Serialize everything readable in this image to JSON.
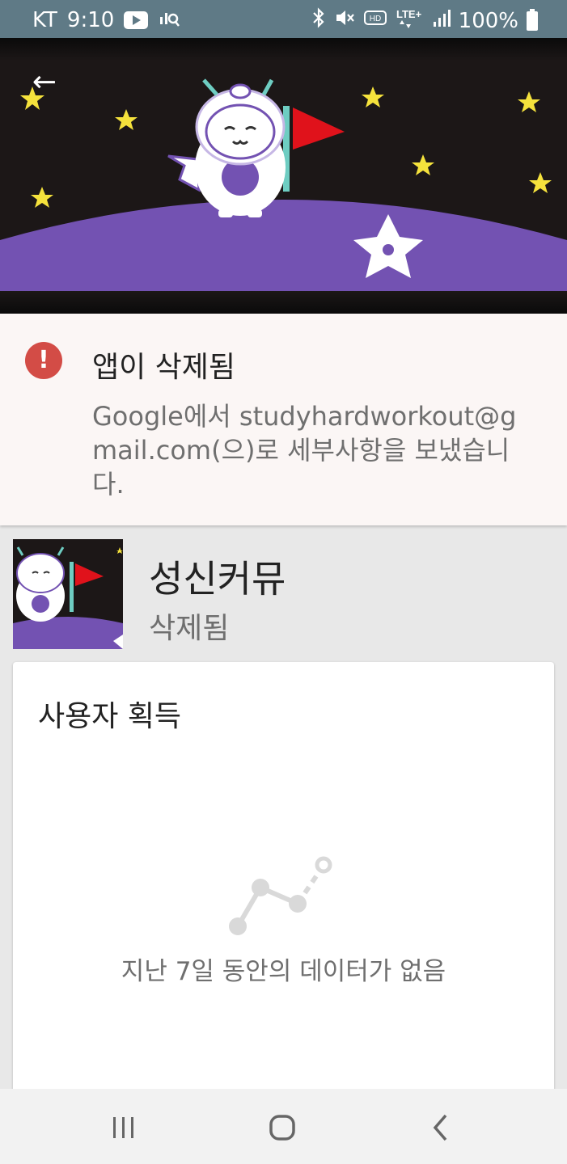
{
  "status_bar": {
    "carrier": "KT",
    "time": "9:10",
    "battery": "100%",
    "icons": [
      "youtube-icon",
      "analytics-icon",
      "bluetooth-icon",
      "mute-icon",
      "hd-icon",
      "lte-icon",
      "signal-icon",
      "battery-icon"
    ]
  },
  "hero": {
    "back_icon": "←",
    "colors": {
      "sky": "#1c1717",
      "ground": "#7352b2",
      "star": "#f5e23c",
      "flag": "#e0121b"
    }
  },
  "alert": {
    "icon": "!",
    "title": "앱이 삭제됨",
    "body": "Google에서 studyhardworkout@gmail.com(으)로 세부사항을 보냈습니다.",
    "color": "#d34c46"
  },
  "app": {
    "name": "성신커뮤",
    "status": "삭제됨"
  },
  "acquisition": {
    "title": "사용자 획득",
    "empty_message": "지난 7일 동안의 데이터가 없음"
  },
  "nav": {
    "recent_icon": "|||",
    "home_icon": "○",
    "back_icon": "‹"
  }
}
